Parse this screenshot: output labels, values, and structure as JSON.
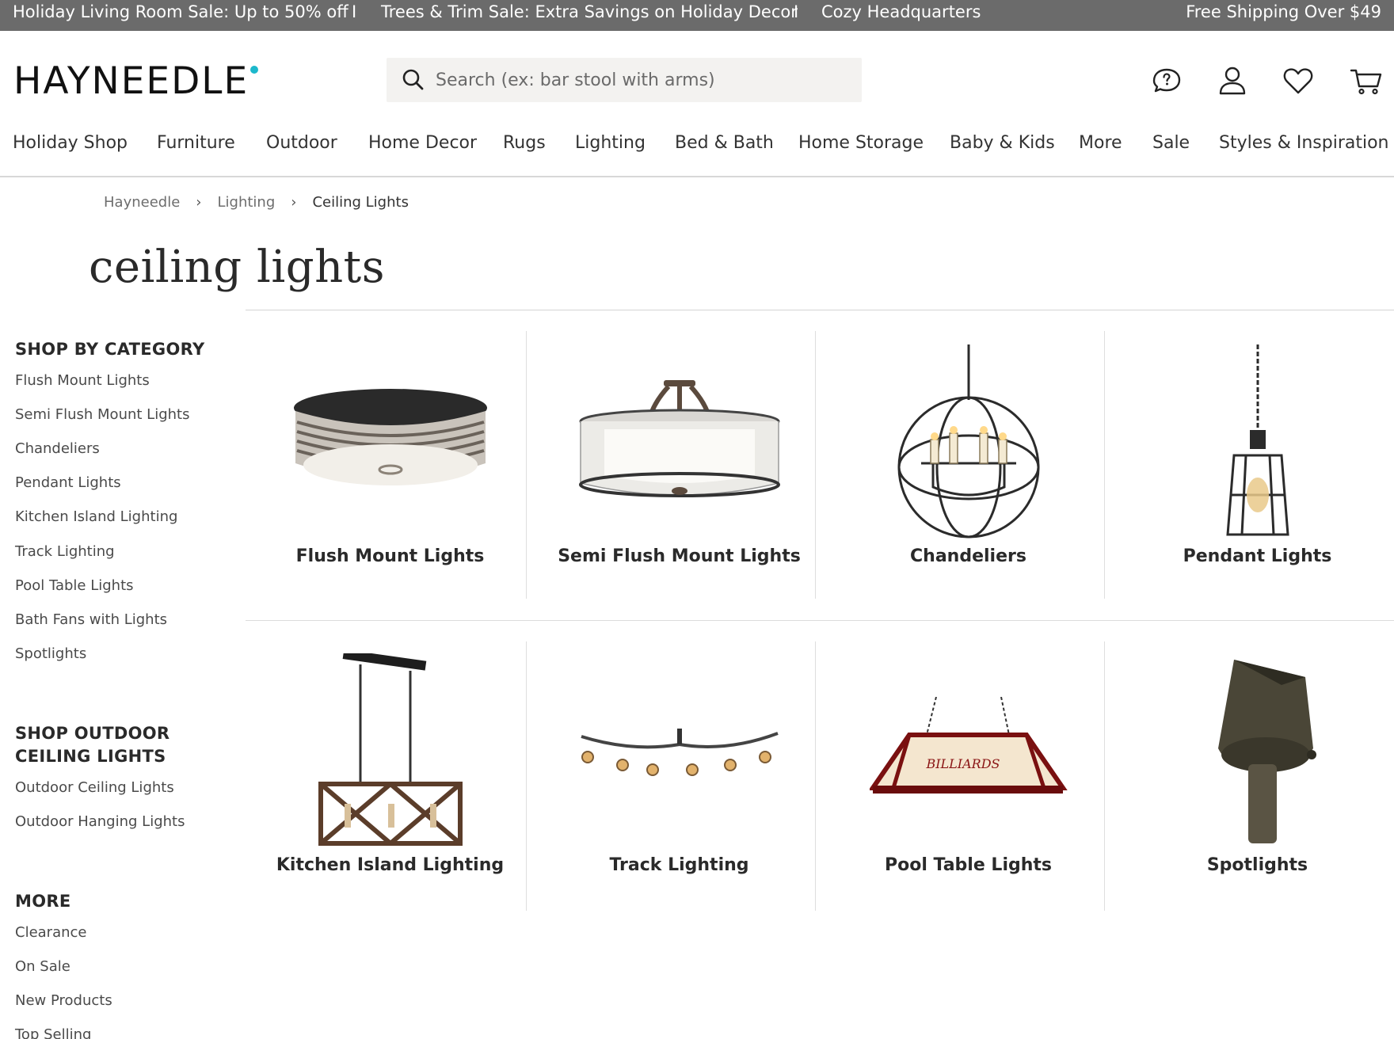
{
  "promo": {
    "messages": [
      "Holiday Living Room Sale: Up to 50% off",
      "Trees & Trim Sale: Extra Savings on Holiday Decor",
      "Cozy Headquarters"
    ],
    "separator": "I",
    "shipping": "Free Shipping Over $49"
  },
  "header": {
    "logo": "HAYNEEDLE",
    "accent_color": "#1cb8cc",
    "search_placeholder": "Search (ex: bar stool with arms)",
    "icons": [
      "help-chat-icon",
      "account-icon",
      "wishlist-heart-icon",
      "cart-icon"
    ]
  },
  "nav": {
    "items": [
      "Holiday Shop",
      "Furniture",
      "Outdoor",
      "Home Decor",
      "Rugs",
      "Lighting",
      "Bed & Bath",
      "Home Storage",
      "Baby & Kids",
      "More",
      "Sale",
      "Styles & Inspiration"
    ]
  },
  "breadcrumb": {
    "items": [
      "Hayneedle",
      "Lighting",
      "Ceiling Lights"
    ]
  },
  "page": {
    "title": "ceiling lights"
  },
  "sidebar": {
    "category_heading": "SHOP BY CATEGORY",
    "category_links": [
      "Flush Mount Lights",
      "Semi Flush Mount Lights",
      "Chandeliers",
      "Pendant Lights",
      "Kitchen Island Lighting",
      "Track Lighting",
      "Pool Table Lights",
      "Bath Fans with Lights",
      "Spotlights"
    ],
    "outdoor_heading_line1": "SHOP OUTDOOR",
    "outdoor_heading_line2": "CEILING LIGHTS",
    "outdoor_links": [
      "Outdoor Ceiling Lights",
      "Outdoor Hanging Lights"
    ],
    "more_heading": "MORE",
    "more_links": [
      "Clearance",
      "On Sale",
      "New Products",
      "Top Selling"
    ]
  },
  "grid": {
    "tiles": [
      {
        "label": "Flush Mount Lights",
        "image": "flush-mount-light"
      },
      {
        "label": "Semi Flush Mount Lights",
        "image": "semi-flush-mount-light"
      },
      {
        "label": "Chandeliers",
        "image": "chandelier"
      },
      {
        "label": "Pendant Lights",
        "image": "pendant-light"
      },
      {
        "label": "Kitchen Island Lighting",
        "image": "kitchen-island-light"
      },
      {
        "label": "Track Lighting",
        "image": "track-lighting"
      },
      {
        "label": "Pool Table Lights",
        "image": "pool-table-light"
      },
      {
        "label": "Spotlights",
        "image": "spotlight"
      }
    ],
    "pool_table_sign_text": "BILLIARDS"
  }
}
